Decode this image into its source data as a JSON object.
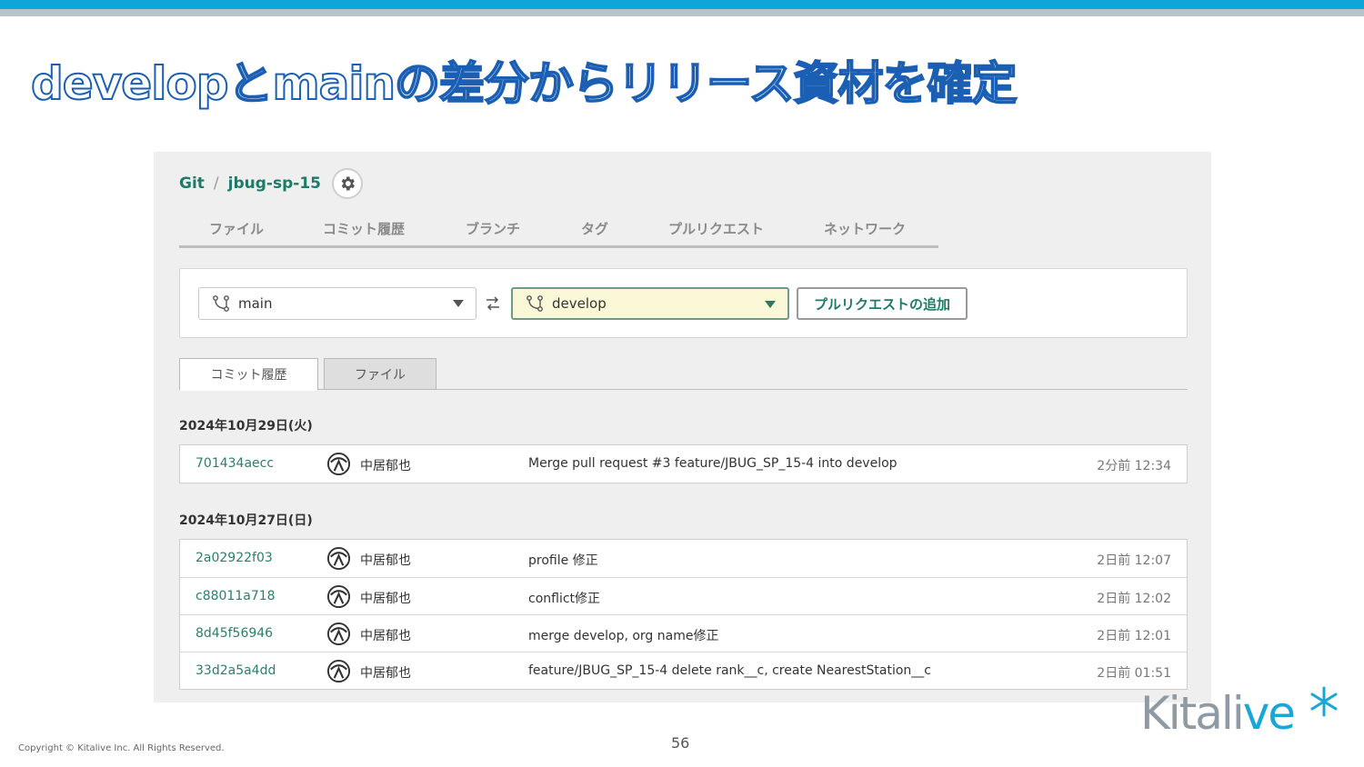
{
  "slide": {
    "title": "developとmainの差分からリリース資材を確定",
    "copyright": "Copyright © Kitalive Inc. All Rights Reserved.",
    "page_number": "56",
    "logo_text_main": "Kitali",
    "logo_text_accent": "ve",
    "colors": {
      "accent_blue": "#0da6d8",
      "title_stroke": "#1a5fb4",
      "link_green": "#1f7a67"
    }
  },
  "app": {
    "breadcrumb": {
      "root": "Git",
      "separator": "/",
      "repo": "jbug-sp-15"
    },
    "settings_icon": "gear-icon",
    "nav_tabs": [
      "ファイル",
      "コミット履歴",
      "ブランチ",
      "タグ",
      "プルリクエスト",
      "ネットワーク"
    ],
    "compare": {
      "base_branch": "main",
      "compare_branch": "develop",
      "swap_icon": "swap-icon",
      "pr_button_label": "プルリクエストの追加"
    },
    "sub_tabs": {
      "active": "コミット履歴",
      "inactive": "ファイル"
    },
    "groups": [
      {
        "date": "2024年10月29日(火)",
        "commits": [
          {
            "hash": "701434aecc",
            "author": "中居郁也",
            "message": "Merge pull request #3 feature/JBUG_SP_15-4 into develop",
            "time": "2分前 12:34"
          }
        ]
      },
      {
        "date": "2024年10月27日(日)",
        "commits": [
          {
            "hash": "2a02922f03",
            "author": "中居郁也",
            "message": "profile 修正",
            "time": "2日前 12:07"
          },
          {
            "hash": "c88011a718",
            "author": "中居郁也",
            "message": "conflict修正",
            "time": "2日前 12:02"
          },
          {
            "hash": "8d45f56946",
            "author": "中居郁也",
            "message": "merge develop, org name修正",
            "time": "2日前 12:01"
          },
          {
            "hash": "33d2a5a4dd",
            "author": "中居郁也",
            "message": "feature/JBUG_SP_15-4 delete rank__c, create NearestStation__c",
            "time": "2日前 01:51"
          }
        ]
      }
    ]
  }
}
